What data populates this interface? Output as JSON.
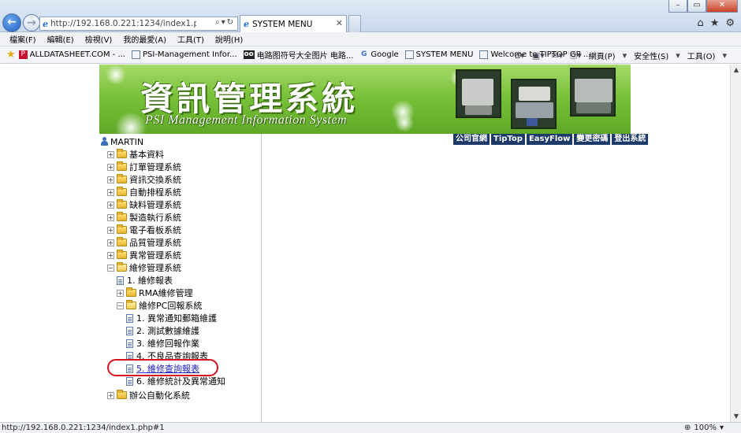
{
  "browser": {
    "address_url": "http://192.168.0.221:1234/index1.php#1",
    "tab_title": "SYSTEM MENU",
    "status_url": "http://192.168.0.221:1234/index1.php#1",
    "zoom": "100%"
  },
  "menubar": [
    "檔案(F)",
    "編輯(E)",
    "檢視(V)",
    "我的最愛(A)",
    "工具(T)",
    "說明(H)"
  ],
  "favorites": [
    {
      "label": "ALLDATASHEET.COM - ...",
      "icon": "pdf-icon"
    },
    {
      "label": "PSI-Management Infor...",
      "icon": "page-icon"
    },
    {
      "label": "电路图符号大全图片 电路...",
      "icon": "oo-icon"
    },
    {
      "label": "Google",
      "icon": "google-icon"
    },
    {
      "label": "SYSTEM MENU",
      "icon": "page-icon"
    },
    {
      "label": "Welcome to TIPTOP GP ...",
      "icon": "page-icon"
    }
  ],
  "commandbar": {
    "page": "網頁(P)",
    "safety": "安全性(S)",
    "tools": "工具(O)"
  },
  "banner": {
    "title": "資訊管理系統",
    "subtitle": "PSI Management Information System"
  },
  "topnav": [
    "公司官網",
    "TipTop",
    "EasyFlow",
    "變更密碼",
    "登出系統"
  ],
  "tree": {
    "user": "MARTIN",
    "items": [
      {
        "label": "基本資料",
        "type": "folder",
        "level": 0,
        "expander": "+"
      },
      {
        "label": "訂單管理系統",
        "type": "folder",
        "level": 0,
        "expander": "+"
      },
      {
        "label": "資訊交換系統",
        "type": "folder",
        "level": 0,
        "expander": "+"
      },
      {
        "label": "自動排程系統",
        "type": "folder",
        "level": 0,
        "expander": "+"
      },
      {
        "label": "缺料管理系統",
        "type": "folder",
        "level": 0,
        "expander": "+"
      },
      {
        "label": "製造執行系統",
        "type": "folder",
        "level": 0,
        "expander": "+"
      },
      {
        "label": "電子看板系統",
        "type": "folder",
        "level": 0,
        "expander": "+"
      },
      {
        "label": "品質管理系統",
        "type": "folder",
        "level": 0,
        "expander": "+"
      },
      {
        "label": "異常管理系統",
        "type": "folder",
        "level": 0,
        "expander": "+"
      },
      {
        "label": "維修管理系統",
        "type": "folder-open",
        "level": 0,
        "expander": "−"
      },
      {
        "label": "1. 維修報表",
        "type": "doc",
        "level": 1
      },
      {
        "label": "RMA維修管理",
        "type": "folder",
        "level": 1,
        "expander": "+"
      },
      {
        "label": "維修PC回報系統",
        "type": "folder-open",
        "level": 1,
        "expander": "−"
      },
      {
        "label": "1. 異常通知郵箱維護",
        "type": "doc",
        "level": 2
      },
      {
        "label": "2. 測試數據維護",
        "type": "doc",
        "level": 2
      },
      {
        "label": "3. 維修回報作業",
        "type": "doc",
        "level": 2
      },
      {
        "label": "4. 不良品查詢報表",
        "type": "doc",
        "level": 2
      },
      {
        "label": "5. 維修查詢報表",
        "type": "doc",
        "level": 2,
        "link": true
      },
      {
        "label": "6. 維修統計及異常通知",
        "type": "doc",
        "level": 2
      },
      {
        "label": "辦公自動化系統",
        "type": "folder",
        "level": 0,
        "expander": "+"
      }
    ]
  },
  "colors": {
    "banner_green": "#79c23a",
    "nav_blue": "#1d3a68",
    "highlight_red": "#d8141e"
  }
}
